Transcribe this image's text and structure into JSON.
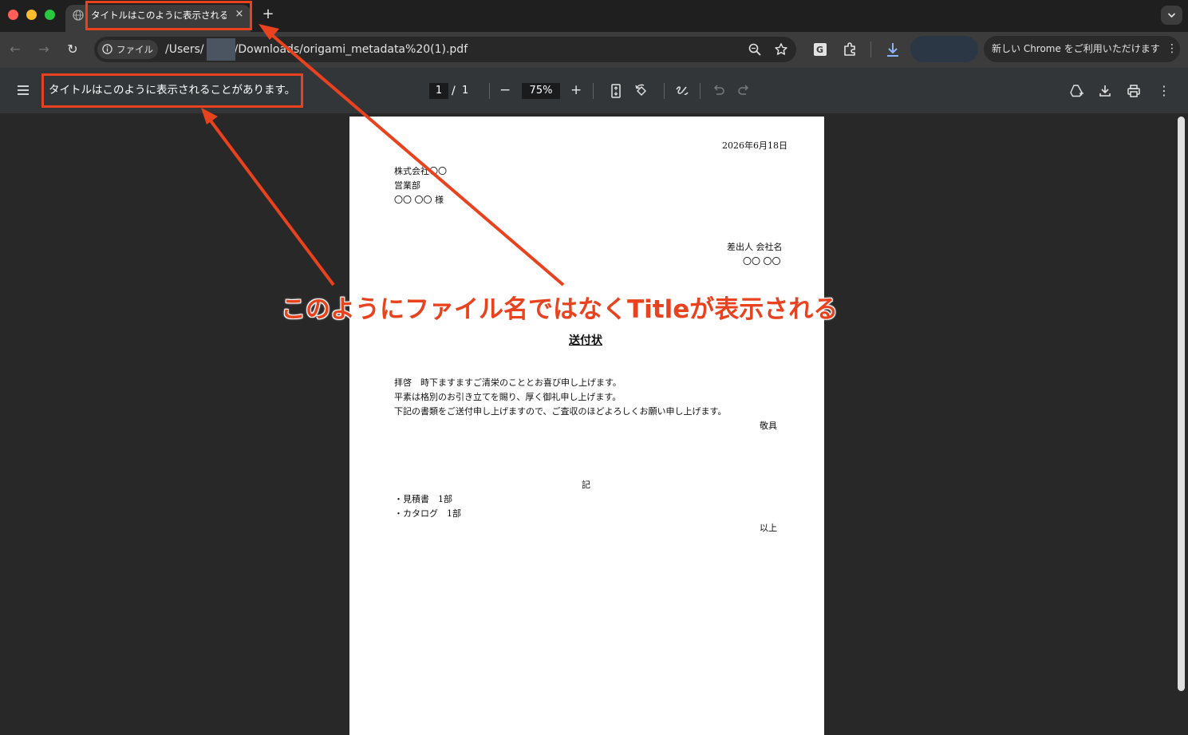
{
  "tab": {
    "title": "タイトルはこのように表示される",
    "close_glyph": "×",
    "new_tab_glyph": "+"
  },
  "toolbar": {
    "back_glyph": "←",
    "forward_glyph": "→",
    "reload_glyph": "↻",
    "chip_label": "ファイル",
    "url_prefix": "/Users/",
    "url_suffix": "/Downloads/origami_metadata%20(1).pdf",
    "update_text": "新しい Chrome をご利用いただけます",
    "update_menu_glyph": "⋮"
  },
  "pdf": {
    "title": "タイトルはこのように表示されることがあります。",
    "page_current": "1",
    "page_sep": "/",
    "page_total": "1",
    "zoom": "75%",
    "zoom_out_glyph": "−",
    "zoom_in_glyph": "+",
    "more_glyph": "⋮"
  },
  "document": {
    "date": "2026年6月18日",
    "recipient_company": "株式会社〇〇",
    "recipient_dept": "営業部",
    "recipient_name": "〇〇 〇〇 様",
    "sender_label": "差出人 会社名",
    "sender_name": "〇〇 〇〇",
    "title": "送付状",
    "body_line1": "拝啓　時下ますますご清栄のこととお喜び申し上げます。",
    "body_line2": "平素は格別のお引き立てを賜り、厚く御礼申し上げます。",
    "body_line3": "下記の書類をご送付申し上げますので、ご査収のほどよろしくお願い申し上げます。",
    "closing": "敬具",
    "ki": "記",
    "item1": "・見積書　1部",
    "item2": "・カタログ　1部",
    "end": "以上"
  },
  "annotation": {
    "text": "このようにファイル名ではなくTitleが表示される",
    "color": "#e8421f"
  }
}
